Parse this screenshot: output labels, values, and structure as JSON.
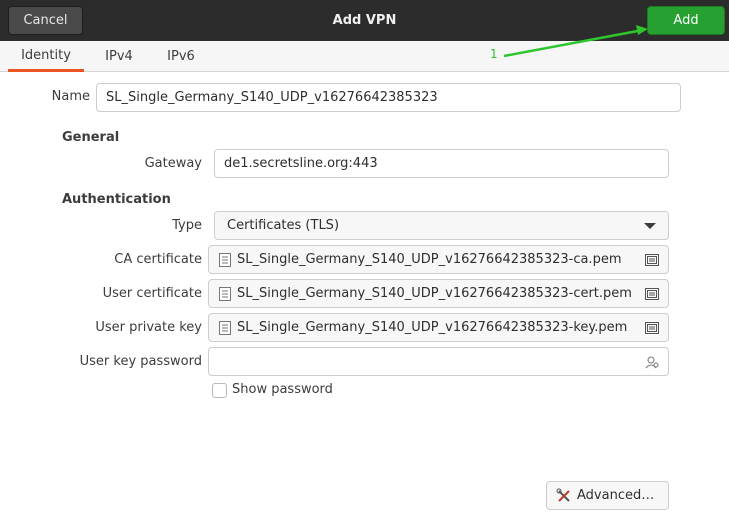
{
  "header": {
    "title": "Add VPN",
    "cancel_label": "Cancel",
    "add_label": "Add"
  },
  "tabs": [
    {
      "label": "Identity",
      "active": true
    },
    {
      "label": "IPv4",
      "active": false
    },
    {
      "label": "IPv6",
      "active": false
    }
  ],
  "annotation": {
    "number": "1",
    "color": "#2ec52e"
  },
  "form": {
    "name_label": "Name",
    "name_value": "SL_Single_Germany_S140_UDP_v16276642385323",
    "general_heading": "General",
    "gateway_label": "Gateway",
    "gateway_value": "de1.secretsline.org:443",
    "auth_heading": "Authentication",
    "type_label": "Type",
    "type_value": "Certificates (TLS)",
    "ca_label": "CA certificate",
    "ca_value": "SL_Single_Germany_S140_UDP_v16276642385323-ca.pem",
    "user_cert_label": "User certificate",
    "user_cert_value": "SL_Single_Germany_S140_UDP_v16276642385323-cert.pem",
    "user_key_label": "User private key",
    "user_key_value": "SL_Single_Germany_S140_UDP_v16276642385323-key.pem",
    "key_password_label": "User key password",
    "key_password_value": "",
    "show_password_label": "Show password",
    "show_password_checked": false
  },
  "advanced_label": "Advanced…",
  "colors": {
    "accent": "#e95420",
    "add_button": "#26a131",
    "headerbar": "#2c2c2c"
  },
  "icons": {
    "file": "document-icon",
    "picker": "file-chooser-icon",
    "password": "password-user-icon",
    "advanced": "wrench-screwdriver-icon"
  }
}
